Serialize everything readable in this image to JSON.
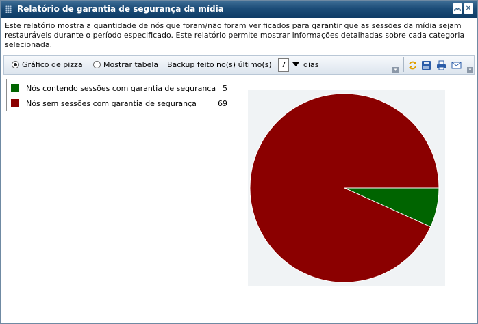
{
  "window": {
    "title": "Relatório de garantia de segurança da mídia",
    "description": "Este relatório mostra a quantidade de nós que foram/não foram verificados para garantir que as sessões da mídia sejam restauráveis durante o período especificado. Este relatório permite mostrar informações detalhadas sobre cada categoria selecionada."
  },
  "toolbar": {
    "pie_option": "Gráfico de pizza",
    "table_option": "Mostrar tabela",
    "backup_label": "Backup feito no(s) último(s)",
    "days_value": "7",
    "days_label": "dias",
    "selected_view": "pie"
  },
  "icons": {
    "refresh": "refresh-icon",
    "save": "save-icon",
    "print": "print-icon",
    "email": "email-icon"
  },
  "chart_data": {
    "type": "pie",
    "categories": [
      "Nós contendo sessões com garantia de segurança",
      "Nós sem sessões com garantia de segurança"
    ],
    "values": [
      5,
      69
    ],
    "colors": [
      "#006400",
      "#8b0000"
    ]
  }
}
